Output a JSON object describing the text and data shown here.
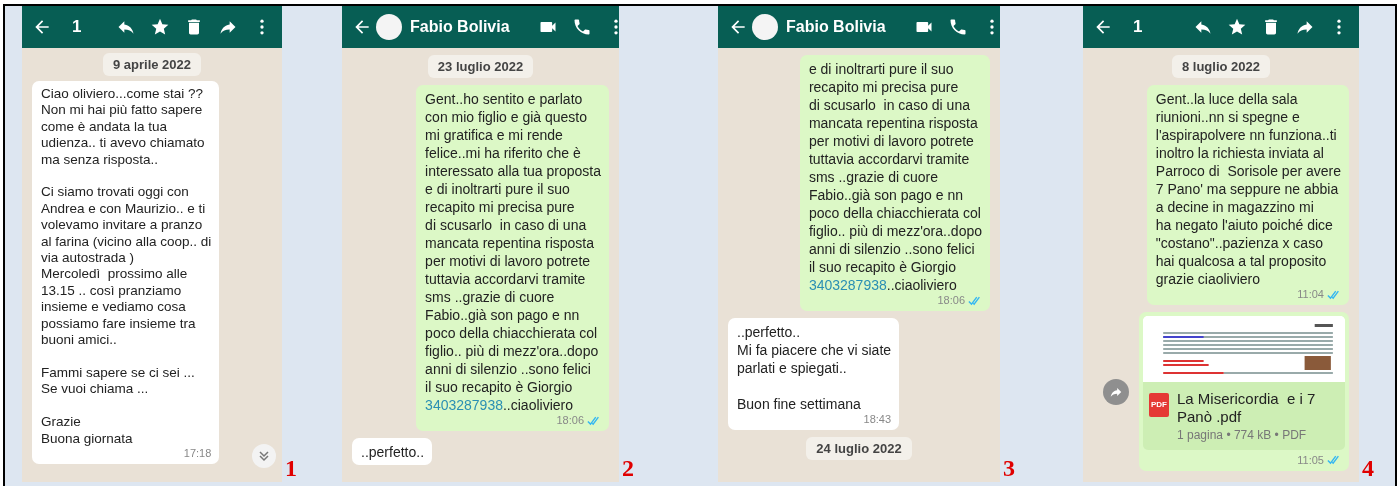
{
  "panels": [
    {
      "number": "1",
      "header": {
        "kind": "selection",
        "count": "1"
      },
      "scroll_button": true,
      "items": [
        {
          "kind": "date",
          "text": "9 aprile 2022"
        },
        {
          "kind": "incoming",
          "text": "Ciao oliviero...come stai ??\nNon mi hai più fatto sapere\ncome è andata la tua\nudienza.. ti avevo chiamato\nma senza risposta..\n\nCi siamo trovati oggi con\nAndrea e con Maurizio.. e ti\nvolevamo invitare a pranzo\nal farina (vicino alla coop.. di\nvia autostrada )\nMercoledì  prossimo alle\n13.15 .. così pranziamo\ninsieme e vediamo cosa\npossiamo fare insieme tra\nbuoni amici..\n\nFammi sapere se ci sei ...\nSe vuoi chiama ...\n\nGrazie\nBuona giornata",
          "time": "17:18"
        }
      ]
    },
    {
      "number": "2",
      "header": {
        "kind": "contact",
        "name": "Fabio Bolivia"
      },
      "scroll_button": false,
      "items": [
        {
          "kind": "date",
          "text": "23 luglio 2022"
        },
        {
          "kind": "outgoing",
          "read": true,
          "text": "Gent..ho sentito e parlato\ncon mio figlio e già questo\nmi gratifica e mi rende\nfelice..mi ha riferito che è\ninteressato alla tua proposta\ne di inoltrarti pure il suo\nrecapito mi precisa pure\ndi scusarlo  in caso di una\nmancata repentina risposta\nper motivi di lavoro potrete\ntuttavia accordarvi tramite\nsms ..grazie di cuore\nFabio..già son pago e nn\npoco della chiacchierata col\nfiglio.. più di mezz'ora..dopo\nanni di silenzio ..sono felici\nil suo recapito è Giorgio\n",
          "link": "3403287938",
          "text_after": "..ciaoliviero",
          "time": "18:06"
        },
        {
          "kind": "incoming",
          "text": "..perfetto.."
        }
      ]
    },
    {
      "number": "3",
      "header": {
        "kind": "contact",
        "name": "Fabio Bolivia"
      },
      "scroll_button": false,
      "items": [
        {
          "kind": "outgoing",
          "read": true,
          "text": "e di inoltrarti pure il suo\nrecapito mi precisa pure\ndi scusarlo  in caso di una\nmancata repentina risposta\nper motivi di lavoro potrete\ntuttavia accordarvi tramite\nsms ..grazie di cuore\nFabio..già son pago e nn\npoco della chiacchierata col\nfiglio.. più di mezz'ora..dopo\nanni di silenzio ..sono felici\nil suo recapito è Giorgio\n",
          "link": "3403287938",
          "text_after": "..ciaoliviero",
          "time": "18:06"
        },
        {
          "kind": "incoming",
          "text": "..perfetto..\nMi fa piacere che vi siate\nparlati e spiegati..\n\nBuon fine settimana",
          "time": "18:43"
        },
        {
          "kind": "date",
          "text": "24 luglio 2022"
        }
      ]
    },
    {
      "number": "4",
      "header": {
        "kind": "selection",
        "count": "1"
      },
      "scroll_button": false,
      "items": [
        {
          "kind": "date",
          "text": "8 luglio 2022"
        },
        {
          "kind": "outgoing",
          "read": true,
          "text": "Gent..la luce della sala\nriunioni..nn si spegne e\nl'aspirapolvere nn funziona..ti\ninoltro la richiesta inviata al\nParroco di  Sorisole per avere\n7 Pano' ma seppure ne abbia\na decine in magazzino mi\nha negato l'aiuto poiché dice\n\"costano\"..pazienza x caso\nhai qualcosa a tal proposito\ngrazie ciaoliviero",
          "time": "11:04"
        },
        {
          "kind": "document",
          "read": true,
          "file_type": "PDF",
          "title": "La Misericordia  e i 7\nPanò .pdf",
          "details": "1 pagina • 774 kB • PDF",
          "time": "11:05"
        }
      ]
    }
  ]
}
